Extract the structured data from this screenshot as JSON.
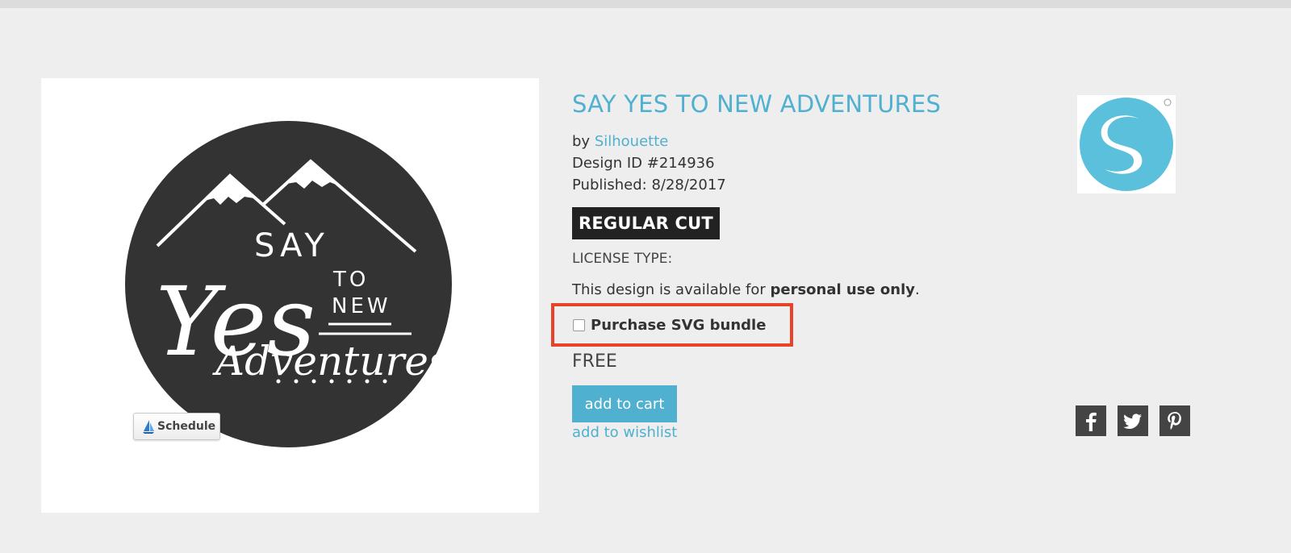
{
  "design": {
    "title": "SAY YES TO NEW ADVENTURES",
    "by_prefix": "by",
    "author": "Silhouette",
    "design_id": "Design ID #214936",
    "published": "Published: 8/28/2017",
    "cut_type": "REGULAR CUT",
    "license_label": "LICENSE TYPE:",
    "license_prefix": "This design is available for ",
    "license_bold": "personal use only",
    "license_suffix": ".",
    "bundle_label": "Purchase SVG bundle",
    "bundle_checked": false,
    "price": "FREE",
    "add_to_cart_label": "add to cart",
    "wishlist_label": "add to wishlist"
  },
  "artwork": {
    "line1": "SAY",
    "line2": "Yes",
    "line3a": "TO",
    "line3b": "NEW",
    "line4": "Adventures"
  },
  "schedule_button": {
    "label": "Schedule",
    "icon": "schedule-sail-icon"
  },
  "social": [
    {
      "name": "facebook",
      "icon": "facebook-icon"
    },
    {
      "name": "twitter",
      "icon": "twitter-icon"
    },
    {
      "name": "pinterest",
      "icon": "pinterest-icon"
    }
  ],
  "colors": {
    "accent": "#4fb0cf",
    "highlight_border": "#e8432a",
    "badge_bg": "#222222",
    "art_circle": "#333333",
    "page_bg": "#eeeeee"
  }
}
